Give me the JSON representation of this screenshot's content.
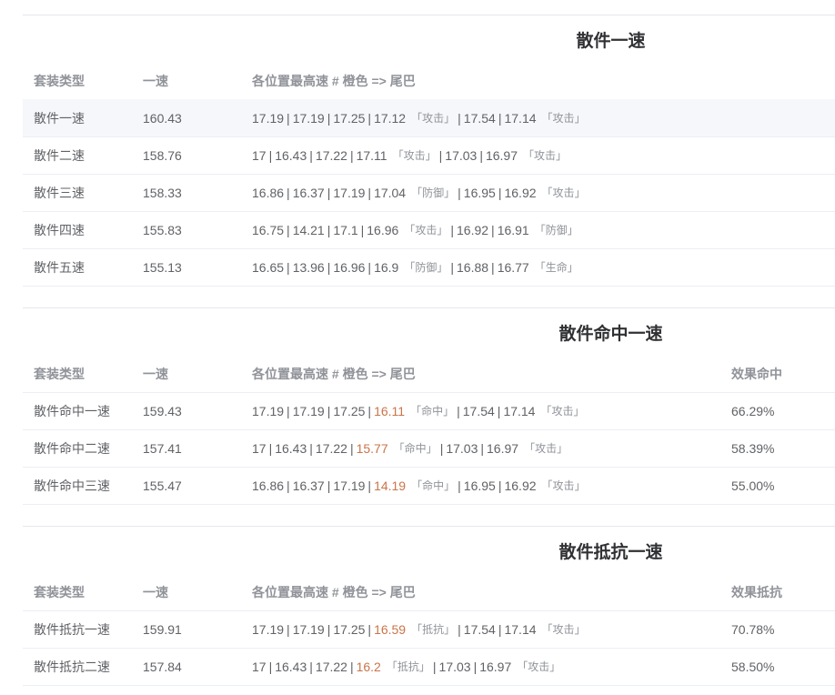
{
  "header_labels": {
    "type": "套装类型",
    "speed": "一速",
    "slots": "各位置最高速 # 橙色 => 尾巴"
  },
  "sections": [
    {
      "title": "散件一速",
      "extra_header": "",
      "rows": [
        {
          "name": "散件一速",
          "speed": "160.43",
          "slots": [
            "17.19",
            "17.19",
            "17.25",
            "17.12"
          ],
          "tag4": "攻击",
          "slots2": [
            "17.54",
            "17.14"
          ],
          "tag6": "攻击",
          "extra": ""
        },
        {
          "name": "散件二速",
          "speed": "158.76",
          "slots": [
            "17",
            "16.43",
            "17.22",
            "17.11"
          ],
          "tag4": "攻击",
          "slots2": [
            "17.03",
            "16.97"
          ],
          "tag6": "攻击",
          "extra": ""
        },
        {
          "name": "散件三速",
          "speed": "158.33",
          "slots": [
            "16.86",
            "16.37",
            "17.19",
            "17.04"
          ],
          "tag4": "防御",
          "slots2": [
            "16.95",
            "16.92"
          ],
          "tag6": "攻击",
          "extra": ""
        },
        {
          "name": "散件四速",
          "speed": "155.83",
          "slots": [
            "16.75",
            "14.21",
            "17.1",
            "16.96"
          ],
          "tag4": "攻击",
          "slots2": [
            "16.92",
            "16.91"
          ],
          "tag6": "防御",
          "extra": ""
        },
        {
          "name": "散件五速",
          "speed": "155.13",
          "slots": [
            "16.65",
            "13.96",
            "16.96",
            "16.9"
          ],
          "tag4": "防御",
          "slots2": [
            "16.88",
            "16.77"
          ],
          "tag6": "生命",
          "extra": ""
        }
      ]
    },
    {
      "title": "散件命中一速",
      "extra_header": "效果命中",
      "rows": [
        {
          "name": "散件命中一速",
          "speed": "159.43",
          "slots": [
            "17.19",
            "17.19",
            "17.25",
            "16.11"
          ],
          "tag4": "命中",
          "slots2": [
            "17.54",
            "17.14"
          ],
          "tag6": "攻击",
          "extra": "66.29%"
        },
        {
          "name": "散件命中二速",
          "speed": "157.41",
          "slots": [
            "17",
            "16.43",
            "17.22",
            "15.77"
          ],
          "tag4": "命中",
          "slots2": [
            "17.03",
            "16.97"
          ],
          "tag6": "攻击",
          "extra": "58.39%"
        },
        {
          "name": "散件命中三速",
          "speed": "155.47",
          "slots": [
            "16.86",
            "16.37",
            "17.19",
            "14.19"
          ],
          "tag4": "命中",
          "slots2": [
            "16.95",
            "16.92"
          ],
          "tag6": "攻击",
          "extra": "55.00%"
        }
      ]
    },
    {
      "title": "散件抵抗一速",
      "extra_header": "效果抵抗",
      "rows": [
        {
          "name": "散件抵抗一速",
          "speed": "159.91",
          "slots": [
            "17.19",
            "17.19",
            "17.25",
            "16.59"
          ],
          "tag4": "抵抗",
          "slots2": [
            "17.54",
            "17.14"
          ],
          "tag6": "攻击",
          "extra": "70.78%"
        },
        {
          "name": "散件抵抗二速",
          "speed": "157.84",
          "slots": [
            "17",
            "16.43",
            "17.22",
            "16.2"
          ],
          "tag4": "抵抗",
          "slots2": [
            "17.03",
            "16.97"
          ],
          "tag6": "攻击",
          "extra": "58.50%"
        }
      ]
    }
  ],
  "colors": {
    "tail": "#c9754a",
    "row_highlight": "#f5f7fa"
  }
}
